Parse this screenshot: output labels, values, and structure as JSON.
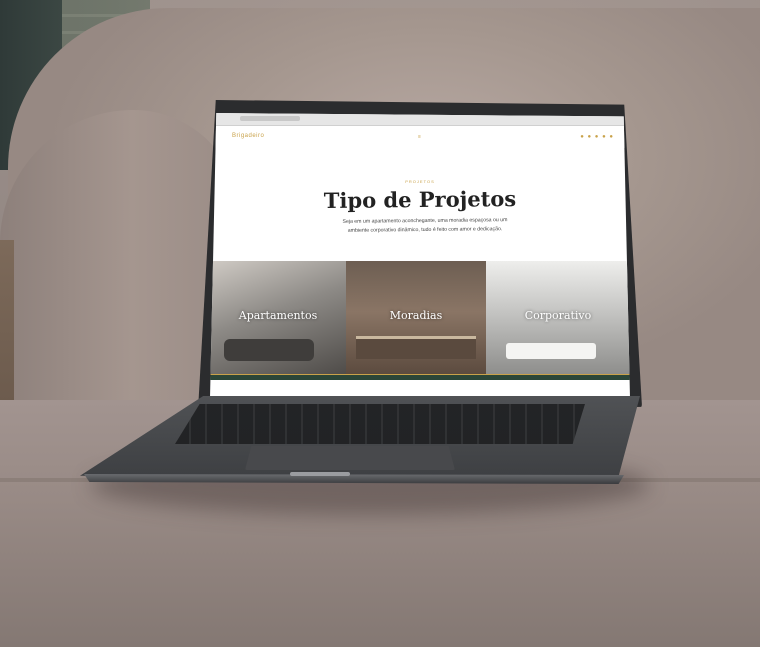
{
  "site": {
    "logo": "Brigadeiro",
    "nav_center": "≡",
    "nav_icons": "● ● ● ● ●"
  },
  "hero": {
    "eyebrow": "PROJETOS",
    "title": "Tipo de Projetos",
    "description": "Seja em um apartamento aconchegante, uma moradia espaçosa ou um ambiente corporativo dinâmico, tudo é feito com amor e dedicação."
  },
  "gallery": {
    "items": [
      {
        "label": "Apartamentos"
      },
      {
        "label": "Moradias"
      },
      {
        "label": "Corporativo"
      }
    ]
  },
  "colors": {
    "accent": "#c9a24a",
    "footer": "#2b4638",
    "laptop": "#2b2c2e"
  }
}
